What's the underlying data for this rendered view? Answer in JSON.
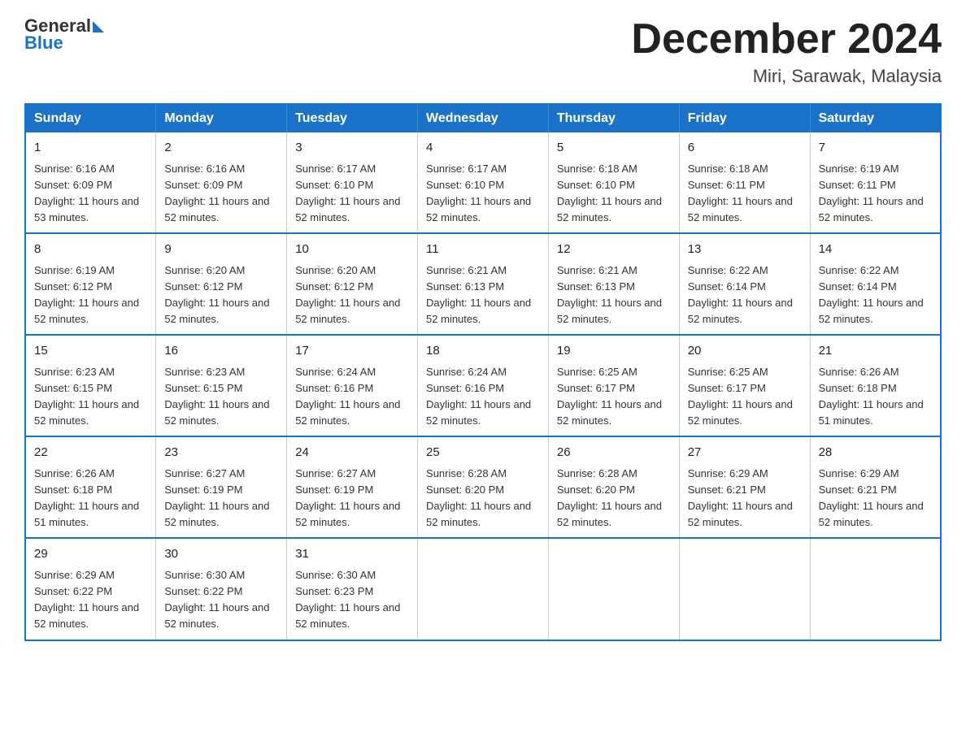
{
  "header": {
    "logo_general": "General",
    "logo_blue": "Blue",
    "month_title": "December 2024",
    "location": "Miri, Sarawak, Malaysia"
  },
  "days_of_week": [
    "Sunday",
    "Monday",
    "Tuesday",
    "Wednesday",
    "Thursday",
    "Friday",
    "Saturday"
  ],
  "weeks": [
    [
      {
        "day": "1",
        "sunrise": "6:16 AM",
        "sunset": "6:09 PM",
        "daylight": "11 hours and 53 minutes."
      },
      {
        "day": "2",
        "sunrise": "6:16 AM",
        "sunset": "6:09 PM",
        "daylight": "11 hours and 52 minutes."
      },
      {
        "day": "3",
        "sunrise": "6:17 AM",
        "sunset": "6:10 PM",
        "daylight": "11 hours and 52 minutes."
      },
      {
        "day": "4",
        "sunrise": "6:17 AM",
        "sunset": "6:10 PM",
        "daylight": "11 hours and 52 minutes."
      },
      {
        "day": "5",
        "sunrise": "6:18 AM",
        "sunset": "6:10 PM",
        "daylight": "11 hours and 52 minutes."
      },
      {
        "day": "6",
        "sunrise": "6:18 AM",
        "sunset": "6:11 PM",
        "daylight": "11 hours and 52 minutes."
      },
      {
        "day": "7",
        "sunrise": "6:19 AM",
        "sunset": "6:11 PM",
        "daylight": "11 hours and 52 minutes."
      }
    ],
    [
      {
        "day": "8",
        "sunrise": "6:19 AM",
        "sunset": "6:12 PM",
        "daylight": "11 hours and 52 minutes."
      },
      {
        "day": "9",
        "sunrise": "6:20 AM",
        "sunset": "6:12 PM",
        "daylight": "11 hours and 52 minutes."
      },
      {
        "day": "10",
        "sunrise": "6:20 AM",
        "sunset": "6:12 PM",
        "daylight": "11 hours and 52 minutes."
      },
      {
        "day": "11",
        "sunrise": "6:21 AM",
        "sunset": "6:13 PM",
        "daylight": "11 hours and 52 minutes."
      },
      {
        "day": "12",
        "sunrise": "6:21 AM",
        "sunset": "6:13 PM",
        "daylight": "11 hours and 52 minutes."
      },
      {
        "day": "13",
        "sunrise": "6:22 AM",
        "sunset": "6:14 PM",
        "daylight": "11 hours and 52 minutes."
      },
      {
        "day": "14",
        "sunrise": "6:22 AM",
        "sunset": "6:14 PM",
        "daylight": "11 hours and 52 minutes."
      }
    ],
    [
      {
        "day": "15",
        "sunrise": "6:23 AM",
        "sunset": "6:15 PM",
        "daylight": "11 hours and 52 minutes."
      },
      {
        "day": "16",
        "sunrise": "6:23 AM",
        "sunset": "6:15 PM",
        "daylight": "11 hours and 52 minutes."
      },
      {
        "day": "17",
        "sunrise": "6:24 AM",
        "sunset": "6:16 PM",
        "daylight": "11 hours and 52 minutes."
      },
      {
        "day": "18",
        "sunrise": "6:24 AM",
        "sunset": "6:16 PM",
        "daylight": "11 hours and 52 minutes."
      },
      {
        "day": "19",
        "sunrise": "6:25 AM",
        "sunset": "6:17 PM",
        "daylight": "11 hours and 52 minutes."
      },
      {
        "day": "20",
        "sunrise": "6:25 AM",
        "sunset": "6:17 PM",
        "daylight": "11 hours and 52 minutes."
      },
      {
        "day": "21",
        "sunrise": "6:26 AM",
        "sunset": "6:18 PM",
        "daylight": "11 hours and 51 minutes."
      }
    ],
    [
      {
        "day": "22",
        "sunrise": "6:26 AM",
        "sunset": "6:18 PM",
        "daylight": "11 hours and 51 minutes."
      },
      {
        "day": "23",
        "sunrise": "6:27 AM",
        "sunset": "6:19 PM",
        "daylight": "11 hours and 52 minutes."
      },
      {
        "day": "24",
        "sunrise": "6:27 AM",
        "sunset": "6:19 PM",
        "daylight": "11 hours and 52 minutes."
      },
      {
        "day": "25",
        "sunrise": "6:28 AM",
        "sunset": "6:20 PM",
        "daylight": "11 hours and 52 minutes."
      },
      {
        "day": "26",
        "sunrise": "6:28 AM",
        "sunset": "6:20 PM",
        "daylight": "11 hours and 52 minutes."
      },
      {
        "day": "27",
        "sunrise": "6:29 AM",
        "sunset": "6:21 PM",
        "daylight": "11 hours and 52 minutes."
      },
      {
        "day": "28",
        "sunrise": "6:29 AM",
        "sunset": "6:21 PM",
        "daylight": "11 hours and 52 minutes."
      }
    ],
    [
      {
        "day": "29",
        "sunrise": "6:29 AM",
        "sunset": "6:22 PM",
        "daylight": "11 hours and 52 minutes."
      },
      {
        "day": "30",
        "sunrise": "6:30 AM",
        "sunset": "6:22 PM",
        "daylight": "11 hours and 52 minutes."
      },
      {
        "day": "31",
        "sunrise": "6:30 AM",
        "sunset": "6:23 PM",
        "daylight": "11 hours and 52 minutes."
      },
      null,
      null,
      null,
      null
    ]
  ]
}
